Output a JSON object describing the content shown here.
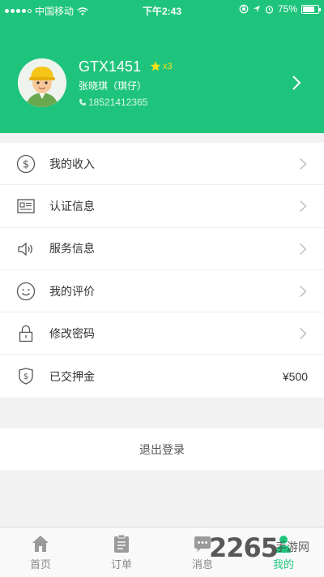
{
  "status_bar": {
    "carrier": "中国移动",
    "time": "下午2:43",
    "battery": "75%",
    "battery_level": 0.75
  },
  "profile": {
    "username": "GTX1451",
    "star_count": "x3",
    "real_name": "张晓琪（琪仔）",
    "phone": "18521412365"
  },
  "menu": [
    {
      "label": "我的收入",
      "icon": "dollar-circle-icon"
    },
    {
      "label": "认证信息",
      "icon": "id-card-icon"
    },
    {
      "label": "服务信息",
      "icon": "speaker-icon"
    },
    {
      "label": "我的评价",
      "icon": "smile-icon"
    },
    {
      "label": "修改密码",
      "icon": "lock-icon"
    },
    {
      "label": "已交押金",
      "icon": "deposit-shield-icon",
      "value": "¥500"
    }
  ],
  "logout_label": "退出登录",
  "tabs": [
    {
      "label": "首页",
      "icon": "home-icon"
    },
    {
      "label": "订单",
      "icon": "clipboard-icon"
    },
    {
      "label": "消息",
      "icon": "chat-icon"
    },
    {
      "label": "我的",
      "icon": "user-icon",
      "active": true
    }
  ],
  "watermark": {
    "text": "2265",
    "suffix": "手游网"
  },
  "colors": {
    "brand": "#1fc47c",
    "star": "#f5e01c"
  }
}
